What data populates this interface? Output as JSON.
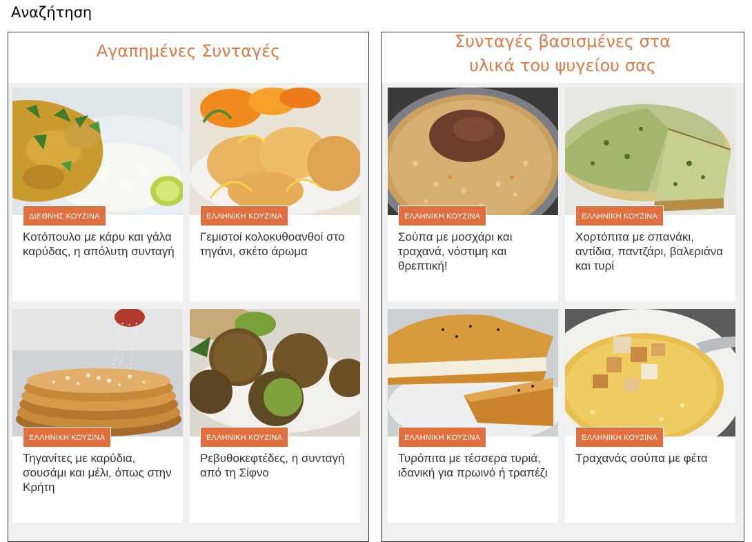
{
  "search_label": "Αναζήτηση",
  "colors": {
    "accent": "#e07040",
    "title": "#e07a45"
  },
  "favorites": {
    "title": "Αγαπημένες Συνταγές",
    "cards": [
      {
        "category": "ΔΙΕΘΝΗΣ ΚΟΥΖΙΝΑ",
        "title": "Κοτόπουλο με κάρυ και γάλα καρύδας, η απόλυτη συνταγή"
      },
      {
        "category": "ΕΛΛΗΝΙΚΗ ΚΟΥΖΙΝΑ",
        "title": "Γεμιστοί κολοκυθοανθοί στο τηγάνι, σκέτο άρωμα"
      },
      {
        "category": "ΕΛΛΗΝΙΚΗ ΚΟΥΖΙΝΑ",
        "title": "Τηγανίτες με καρύδια, σουσάμι και μέλι, όπως στην Κρήτη"
      },
      {
        "category": "ΕΛΛΗΝΙΚΗ ΚΟΥΖΙΝΑ",
        "title": "Ρεβυθοκεφτέδες, η συνταγή από τη Σίφνο"
      }
    ]
  },
  "fridge": {
    "title_line1": "Συνταγές βασισμένες στα",
    "title_line2": "υλικά του ψυγείου σας",
    "cards": [
      {
        "category": "ΕΛΛΗΝΙΚΗ ΚΟΥΖΙΝΑ",
        "title": "Σούπα με μοσχάρι και τραχανά, νόστιμη και θρεπτική!"
      },
      {
        "category": "ΕΛΛΗΝΙΚΗ ΚΟΥΖΙΝΑ",
        "title": "Χορτόπιτα με σπανάκι, αντίδια, παντζάρι, βαλεριάνα και τυρί"
      },
      {
        "category": "ΕΛΛΗΝΙΚΗ ΚΟΥΖΙΝΑ",
        "title": "Τυρόπιτα με τέσσερα τυριά, ιδανική για πρωινό ή τραπέζι"
      },
      {
        "category": "ΕΛΛΗΝΙΚΗ ΚΟΥΖΙΝΑ",
        "title": "Τραχανάς σούπα με φέτα"
      }
    ]
  }
}
